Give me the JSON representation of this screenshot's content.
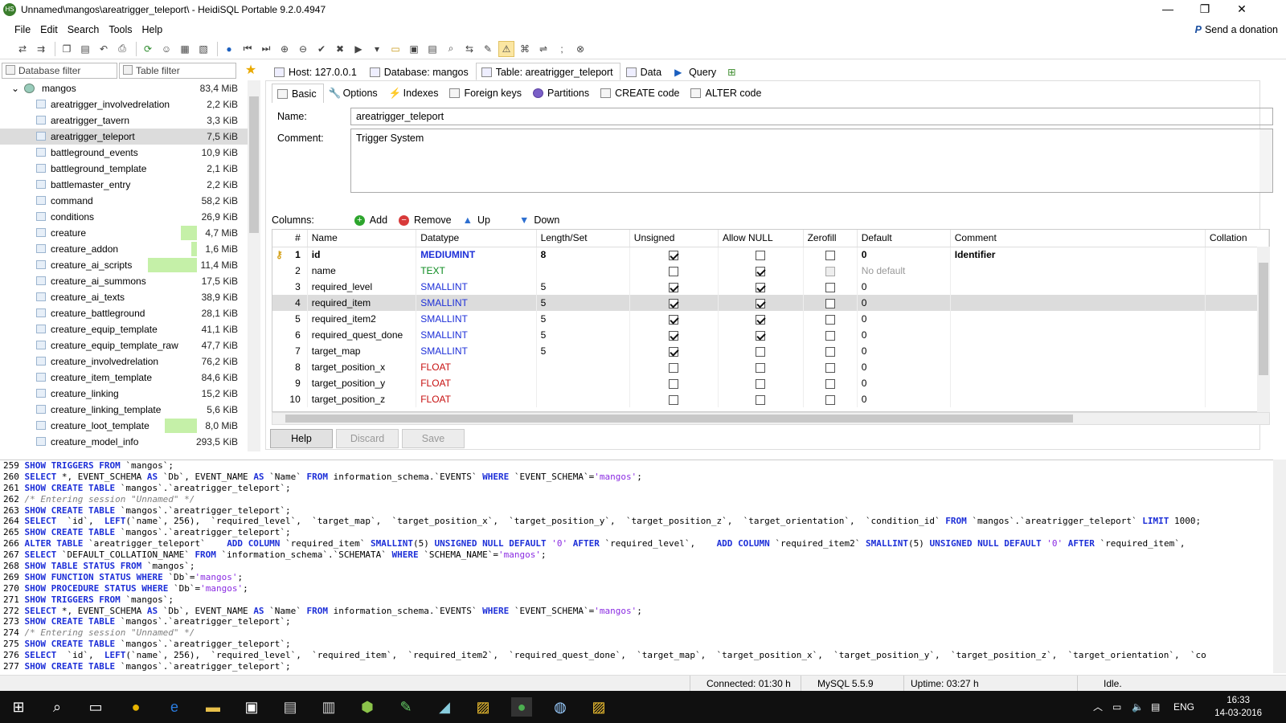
{
  "window": {
    "title": "Unnamed\\mangos\\areatrigger_teleport\\ - HeidiSQL Portable 9.2.0.4947",
    "app_icon": "HS",
    "minimize": "—",
    "maximize": "❐",
    "close": "✕"
  },
  "menu": {
    "items": [
      "File",
      "Edit",
      "Search",
      "Tools",
      "Help"
    ],
    "donate": "Send a donation",
    "donate_icon": "P"
  },
  "filters": {
    "db": "Database filter",
    "table": "Table filter"
  },
  "tree": {
    "root": {
      "name": "mangos",
      "size": "83,4 MiB"
    },
    "items": [
      {
        "name": "areatrigger_involvedrelation",
        "size": "2,2 KiB",
        "fill": 0
      },
      {
        "name": "areatrigger_tavern",
        "size": "3,3 KiB",
        "fill": 0
      },
      {
        "name": "areatrigger_teleport",
        "size": "7,5 KiB",
        "fill": 0
      },
      {
        "name": "battleground_events",
        "size": "10,9 KiB",
        "fill": 0
      },
      {
        "name": "battleground_template",
        "size": "2,1 KiB",
        "fill": 0
      },
      {
        "name": "battlemaster_entry",
        "size": "2,2 KiB",
        "fill": 0
      },
      {
        "name": "command",
        "size": "58,2 KiB",
        "fill": 0
      },
      {
        "name": "conditions",
        "size": "26,9 KiB",
        "fill": 0
      },
      {
        "name": "creature",
        "size": "4,7 MiB",
        "fill": 0.17
      },
      {
        "name": "creature_addon",
        "size": "1,6 MiB",
        "fill": 0.06
      },
      {
        "name": "creature_ai_scripts",
        "size": "11,4 MiB",
        "fill": 0.53
      },
      {
        "name": "creature_ai_summons",
        "size": "17,5 KiB",
        "fill": 0
      },
      {
        "name": "creature_ai_texts",
        "size": "38,9 KiB",
        "fill": 0
      },
      {
        "name": "creature_battleground",
        "size": "28,1 KiB",
        "fill": 0
      },
      {
        "name": "creature_equip_template",
        "size": "41,1 KiB",
        "fill": 0
      },
      {
        "name": "creature_equip_template_raw",
        "size": "47,7 KiB",
        "fill": 0
      },
      {
        "name": "creature_involvedrelation",
        "size": "76,2 KiB",
        "fill": 0
      },
      {
        "name": "creature_item_template",
        "size": "84,6 KiB",
        "fill": 0
      },
      {
        "name": "creature_linking",
        "size": "15,2 KiB",
        "fill": 0
      },
      {
        "name": "creature_linking_template",
        "size": "5,6 KiB",
        "fill": 0
      },
      {
        "name": "creature_loot_template",
        "size": "8,0 MiB",
        "fill": 0.35
      },
      {
        "name": "creature_model_info",
        "size": "293,5 KiB",
        "fill": 0
      }
    ],
    "selected": 2
  },
  "maintabs": [
    {
      "label": "Host: 127.0.0.1"
    },
    {
      "label": "Database: mangos"
    },
    {
      "label": "Table: areatrigger_teleport"
    },
    {
      "label": "Data"
    },
    {
      "label": "Query"
    }
  ],
  "subtabs": [
    {
      "label": "Basic"
    },
    {
      "label": "Options"
    },
    {
      "label": "Indexes"
    },
    {
      "label": "Foreign keys"
    },
    {
      "label": "Partitions"
    },
    {
      "label": "CREATE code"
    },
    {
      "label": "ALTER code"
    }
  ],
  "form": {
    "name_label": "Name:",
    "name_value": "areatrigger_teleport",
    "comment_label": "Comment:",
    "comment_value": "Trigger System"
  },
  "columns_bar": {
    "label": "Columns:",
    "add": "Add",
    "remove": "Remove",
    "up": "Up",
    "down": "Down"
  },
  "grid": {
    "headers": [
      "#",
      "Name",
      "Datatype",
      "Length/Set",
      "Unsigned",
      "Allow NULL",
      "Zerofill",
      "Default",
      "Comment",
      "Collation"
    ],
    "rows": [
      {
        "n": "1",
        "name": "id",
        "type": "MEDIUMINT",
        "tc": "blue",
        "len": "8",
        "uns": true,
        "nul": false,
        "zero": false,
        "def": "0",
        "comment": "Identifier",
        "bold": true,
        "key": true
      },
      {
        "n": "2",
        "name": "name",
        "type": "TEXT",
        "tc": "green",
        "len": "",
        "uns": false,
        "nul": true,
        "zero": false,
        "def": "No default",
        "comment": "",
        "dis": true
      },
      {
        "n": "3",
        "name": "required_level",
        "type": "SMALLINT",
        "tc": "blue",
        "len": "5",
        "uns": true,
        "nul": true,
        "zero": false,
        "def": "0",
        "comment": ""
      },
      {
        "n": "4",
        "name": "required_item",
        "type": "SMALLINT",
        "tc": "blue",
        "len": "5",
        "uns": true,
        "nul": true,
        "zero": false,
        "def": "0",
        "comment": "",
        "sel": true
      },
      {
        "n": "5",
        "name": "required_item2",
        "type": "SMALLINT",
        "tc": "blue",
        "len": "5",
        "uns": true,
        "nul": true,
        "zero": false,
        "def": "0",
        "comment": ""
      },
      {
        "n": "6",
        "name": "required_quest_done",
        "type": "SMALLINT",
        "tc": "blue",
        "len": "5",
        "uns": true,
        "nul": true,
        "zero": false,
        "def": "0",
        "comment": ""
      },
      {
        "n": "7",
        "name": "target_map",
        "type": "SMALLINT",
        "tc": "blue",
        "len": "5",
        "uns": true,
        "nul": false,
        "zero": false,
        "def": "0",
        "comment": ""
      },
      {
        "n": "8",
        "name": "target_position_x",
        "type": "FLOAT",
        "tc": "red",
        "len": "",
        "uns": false,
        "nul": false,
        "zero": false,
        "def": "0",
        "comment": ""
      },
      {
        "n": "9",
        "name": "target_position_y",
        "type": "FLOAT",
        "tc": "red",
        "len": "",
        "uns": false,
        "nul": false,
        "zero": false,
        "def": "0",
        "comment": ""
      },
      {
        "n": "10",
        "name": "target_position_z",
        "type": "FLOAT",
        "tc": "red",
        "len": "",
        "uns": false,
        "nul": false,
        "zero": false,
        "def": "0",
        "comment": ""
      }
    ]
  },
  "buttons": {
    "help": "Help",
    "discard": "Discard",
    "save": "Save"
  },
  "sql_log": [
    "259 SHOW TRIGGERS FROM `mangos`;",
    "260 SELECT *, EVENT_SCHEMA AS `Db`, EVENT_NAME AS `Name` FROM information_schema.`EVENTS` WHERE `EVENT_SCHEMA`='mangos';",
    "261 SHOW CREATE TABLE `mangos`.`areatrigger_teleport`;",
    "262 /* Entering session \"Unnamed\" */",
    "263 SHOW CREATE TABLE `mangos`.`areatrigger_teleport`;",
    "264 SELECT  `id`,  LEFT(`name`, 256),  `required_level`,  `target_map`,  `target_position_x`,  `target_position_y`,  `target_position_z`,  `target_orientation`,  `condition_id` FROM `mangos`.`areatrigger_teleport` LIMIT 1000;",
    "265 SHOW CREATE TABLE `mangos`.`areatrigger_teleport`;",
    "266 ALTER TABLE `areatrigger_teleport`    ADD COLUMN `required_item` SMALLINT(5) UNSIGNED NULL DEFAULT '0' AFTER `required_level`,    ADD COLUMN `required_item2` SMALLINT(5) UNSIGNED NULL DEFAULT '0' AFTER `required_item`,",
    "267 SELECT `DEFAULT_COLLATION_NAME` FROM `information_schema`.`SCHEMATA` WHERE `SCHEMA_NAME`='mangos';",
    "268 SHOW TABLE STATUS FROM `mangos`;",
    "269 SHOW FUNCTION STATUS WHERE `Db`='mangos';",
    "270 SHOW PROCEDURE STATUS WHERE `Db`='mangos';",
    "271 SHOW TRIGGERS FROM `mangos`;",
    "272 SELECT *, EVENT_SCHEMA AS `Db`, EVENT_NAME AS `Name` FROM information_schema.`EVENTS` WHERE `EVENT_SCHEMA`='mangos';",
    "273 SHOW CREATE TABLE `mangos`.`areatrigger_teleport`;",
    "274 /* Entering session \"Unnamed\" */",
    "275 SHOW CREATE TABLE `mangos`.`areatrigger_teleport`;",
    "276 SELECT  `id`,  LEFT(`name`, 256),  `required_level`,  `required_item`,  `required_item2`,  `required_quest_done`,  `target_map`,  `target_position_x`,  `target_position_y`,  `target_position_z`,  `target_orientation`,  `co",
    "277 SHOW CREATE TABLE `mangos`.`areatrigger_teleport`;"
  ],
  "status": {
    "connected": "Connected: 01:30 h",
    "server": "MySQL 5.5.9",
    "uptime": "Uptime: 03:27 h",
    "state": "Idle."
  },
  "taskbar": {
    "lang": "ENG",
    "time": "16:33",
    "date": "14-03-2016"
  },
  "colors": {
    "keyword": "#1d2fd8",
    "string": "#8a2be2",
    "comment": "#808080",
    "size_bar": "#c5f0a8",
    "selection": "#dcdcdc"
  }
}
